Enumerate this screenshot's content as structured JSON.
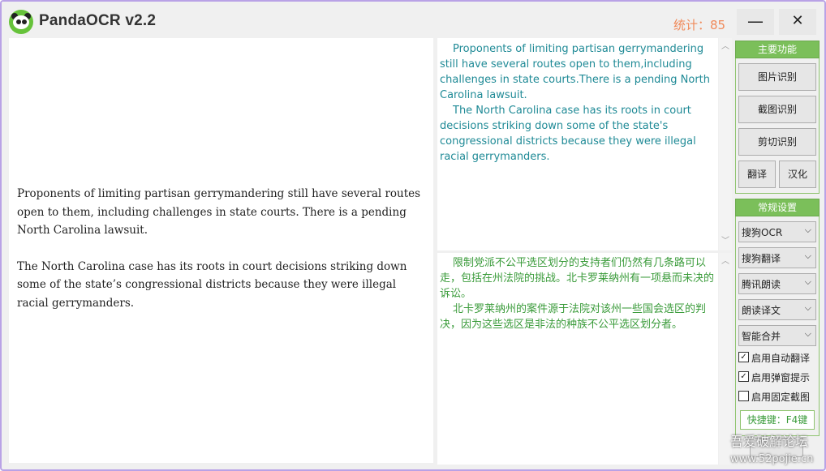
{
  "app": {
    "title": "PandaOCR v2.2",
    "stats": "统计：85"
  },
  "window_controls": {
    "minimize": "—",
    "close": "✕"
  },
  "input": {
    "paragraphs": [
      "Proponents of limiting partisan gerrymandering still have several routes open to them, including challenges in state courts. There is a pending North Carolina lawsuit.",
      "The North Carolina case has its roots in court decisions striking down some of the state’s congressional districts because they were illegal racial gerrymanders."
    ]
  },
  "ocr_result": {
    "paragraphs": [
      "Proponents of limiting partisan gerrymandering still have several routes open to them,including challenges in state courts.There is a pending North Carolina lawsuit.",
      "The North Carolina case has its roots in court decisions striking down some of the state's congressional districts because they were illegal racial gerrymanders."
    ],
    "color": "#1f8a96"
  },
  "translation": {
    "paragraphs": [
      "限制党派不公平选区划分的支持者们仍然有几条路可以走，包括在州法院的挑战。北卡罗莱纳州有一项悬而未决的诉讼。",
      "北卡罗莱纳州的案件源于法院对该州一些国会选区的判决，因为这些选区是非法的种族不公平选区划分者。"
    ],
    "color": "#3a9b3a"
  },
  "main_functions": {
    "header": "主要功能",
    "image_ocr": "图片识别",
    "screenshot_ocr": "截图识别",
    "clipboard_ocr": "剪切识别",
    "translate": "翻译",
    "chinese": "汉化"
  },
  "settings": {
    "header": "常规设置",
    "ocr_engine": "搜狗OCR",
    "translate_engine": "搜狗翻译",
    "tts_engine": "腾讯朗读",
    "tts_language": "朗读译文",
    "merge_mode": "智能合并",
    "auto_translate": {
      "label": "启用自动翻译",
      "checked": true
    },
    "popup_hint": {
      "label": "启用弹窗提示",
      "checked": true
    },
    "fixed_screenshot": {
      "label": "启用固定截图",
      "checked": false
    },
    "hotkey": "快捷键：F4键"
  },
  "watermark": {
    "line1": "吾爱破解论坛",
    "line2": "www.52pojie.cn"
  },
  "colors": {
    "accent_green": "#7bbf5a",
    "stats_orange": "#f08a5a",
    "window_border": "#b9a2e6"
  }
}
